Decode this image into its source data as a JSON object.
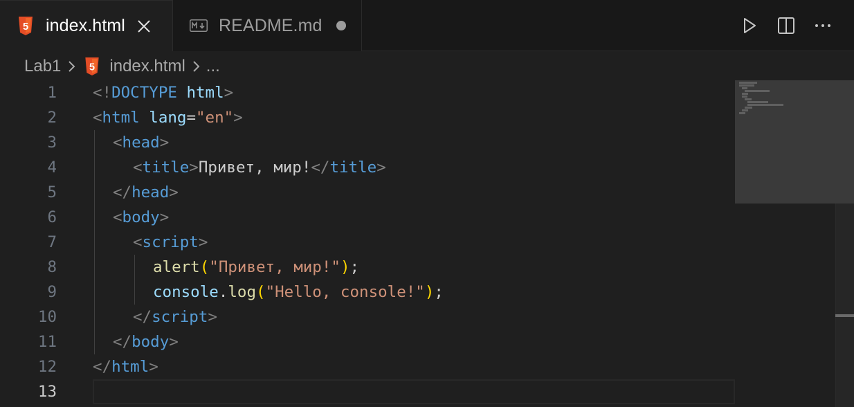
{
  "tabs": [
    {
      "label": "index.html",
      "icon": "html5-icon",
      "active": true,
      "closeable": true
    },
    {
      "label": "README.md",
      "icon": "markdown-icon",
      "active": false,
      "dirty": true
    }
  ],
  "breadcrumb": {
    "folder": "Lab1",
    "file": "index.html",
    "symbol": "..."
  },
  "editor": {
    "current_line": 13,
    "lines": [
      {
        "n": "1"
      },
      {
        "n": "2"
      },
      {
        "n": "3"
      },
      {
        "n": "4"
      },
      {
        "n": "5"
      },
      {
        "n": "6"
      },
      {
        "n": "7"
      },
      {
        "n": "8"
      },
      {
        "n": "9"
      },
      {
        "n": "10"
      },
      {
        "n": "11"
      },
      {
        "n": "12"
      },
      {
        "n": "13"
      }
    ],
    "tokens": {
      "l1": [
        "<!",
        "DOCTYPE",
        " html",
        ">"
      ],
      "l2": [
        "<",
        "html",
        " ",
        "lang",
        "=",
        "\"en\"",
        ">"
      ],
      "l3": [
        "<",
        "head",
        ">"
      ],
      "l4": [
        "<",
        "title",
        ">",
        "Привет, мир!",
        "</",
        "title",
        ">"
      ],
      "l5": [
        "</",
        "head",
        ">"
      ],
      "l6": [
        "<",
        "body",
        ">"
      ],
      "l7": [
        "<",
        "script",
        ">"
      ],
      "l8": [
        "alert",
        "(",
        "\"Привет, мир!\"",
        ")",
        ";"
      ],
      "l9": [
        "console",
        ".",
        "log",
        "(",
        "\"Hello, console!\"",
        ")",
        ";"
      ],
      "l10": [
        "</",
        "script",
        ">"
      ],
      "l11": [
        "</",
        "body",
        ">"
      ],
      "l12": [
        "</",
        "html",
        ">"
      ]
    }
  },
  "colors": {
    "background": "#1f1f1f",
    "tag": "#569cd6",
    "attribute": "#9cdcfe",
    "string": "#ce9178",
    "function": "#dcdcaa",
    "bracket": "#ffd700",
    "html5_brand": "#e44d26"
  },
  "actions": [
    {
      "name": "run-icon"
    },
    {
      "name": "split-editor-icon"
    },
    {
      "name": "more-actions-icon"
    }
  ]
}
